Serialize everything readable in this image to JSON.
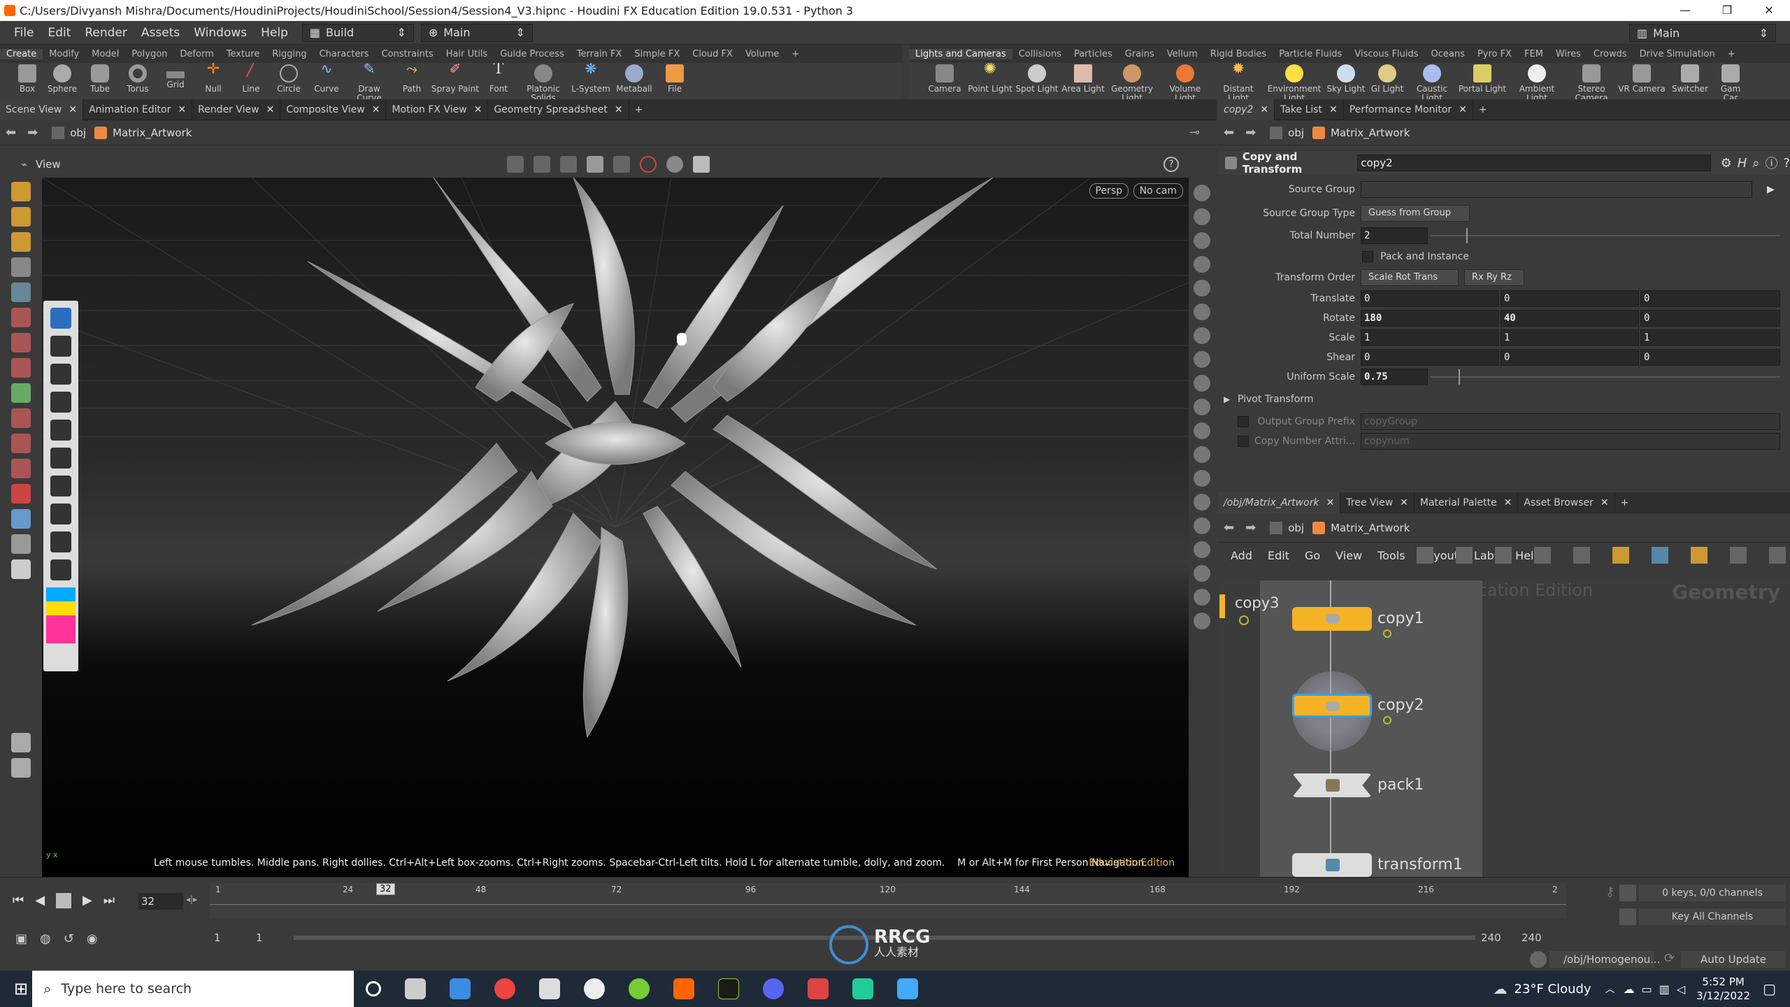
{
  "window": {
    "title": "C:/Users/Divyansh Mishra/Documents/HoudiniProjects/HoudiniSchool/Session4/Session4_V3.hipnc - Houdini FX Education Edition 19.0.531 - Python 3",
    "min": "—",
    "max": "❐",
    "close": "✕"
  },
  "menubar": {
    "items": [
      "File",
      "Edit",
      "Render",
      "Assets",
      "Windows",
      "Help"
    ],
    "desktop": "Build",
    "context": "Main",
    "right_context": "Main"
  },
  "shelf_left": {
    "tabs": [
      "Create",
      "Modify",
      "Model",
      "Polygon",
      "Deform",
      "Texture",
      "Rigging",
      "Characters",
      "Constraints",
      "Hair Utils",
      "Guide Process",
      "Terrain FX",
      "Simple FX",
      "Cloud FX",
      "Volume",
      "+"
    ],
    "tools": [
      "Box",
      "Sphere",
      "Tube",
      "Torus",
      "Grid",
      "Null",
      "Line",
      "Circle",
      "Curve",
      "Draw Curve",
      "Path",
      "Spray Paint",
      "Font",
      "Platonic Solids",
      "L-System",
      "Metaball",
      "File"
    ]
  },
  "shelf_right": {
    "tabs": [
      "Lights and Cameras",
      "Collisions",
      "Particles",
      "Grains",
      "Vellum",
      "Rigid Bodies",
      "Particle Fluids",
      "Viscous Fluids",
      "Oceans",
      "Pyro FX",
      "FEM",
      "Wires",
      "Crowds",
      "Drive Simulation",
      "+"
    ],
    "tools": [
      "Camera",
      "Point Light",
      "Spot Light",
      "Area Light",
      "Geometry Light",
      "Volume Light",
      "Distant Light",
      "Environment Light",
      "Sky Light",
      "GI Light",
      "Caustic Light",
      "Portal Light",
      "Ambient Light",
      "Stereo Camera",
      "VR Camera",
      "Switcher",
      "Gam Car"
    ]
  },
  "left_pane": {
    "tabs": [
      "Scene View",
      "Animation Editor",
      "Render View",
      "Composite View",
      "Motion FX View",
      "Geometry Spreadsheet",
      "+"
    ],
    "path": [
      "obj",
      "Matrix_Artwork"
    ],
    "view_label": "View",
    "persp": "Persp",
    "cam": "No cam",
    "help_text": "Left mouse tumbles. Middle pans. Right dollies. Ctrl+Alt+Left box-zooms. Ctrl+Right zooms. Spacebar-Ctrl-Left tilts. Hold L for alternate tumble, dolly, and zoom.    M or Alt+M for First Person Navigation.",
    "edition": "Education Edition"
  },
  "param_pane": {
    "tabs": [
      "copy2",
      "Take List",
      "Performance Monitor",
      "+"
    ],
    "path": [
      "obj",
      "Matrix_Artwork"
    ],
    "node_type": "Copy and Transform",
    "node_name": "copy2",
    "source_group_label": "Source Group",
    "source_group_value": "",
    "source_group_type_label": "Source Group Type",
    "source_group_type_value": "Guess from Group",
    "total_number_label": "Total Number",
    "total_number_value": "2",
    "pack_label": "Pack and Instance",
    "transform_order_label": "Transform Order",
    "transform_order_value": "Scale Rot Trans",
    "rot_order_value": "Rx Ry Rz",
    "translate_label": "Translate",
    "translate": [
      "0",
      "0",
      "0"
    ],
    "rotate_label": "Rotate",
    "rotate": [
      "180",
      "40",
      "0"
    ],
    "scale_label": "Scale",
    "scale": [
      "1",
      "1",
      "1"
    ],
    "shear_label": "Shear",
    "shear": [
      "0",
      "0",
      "0"
    ],
    "uniform_scale_label": "Uniform Scale",
    "uniform_scale_value": "0.75",
    "pivot_label": "Pivot Transform",
    "output_group_label": "Output Group Prefix",
    "output_group_value": "copyGroup",
    "copy_attr_label": "Copy Number Attri...",
    "copy_attr_value": "copynum"
  },
  "network_pane": {
    "tabs": [
      "/obj/Matrix_Artwork",
      "Tree View",
      "Material Palette",
      "Asset Browser",
      "+"
    ],
    "path": [
      "obj",
      "Matrix_Artwork"
    ],
    "menu": [
      "Add",
      "Edit",
      "Go",
      "View",
      "Tools",
      "Layout",
      "Labs",
      "Help"
    ],
    "watermark_edition": "Education Edition",
    "watermark_context": "Geometry",
    "nodes": [
      "copy3",
      "copy1",
      "copy2",
      "pack1",
      "transform1"
    ]
  },
  "timeline": {
    "current_frame": "32",
    "ticks": [
      "1",
      "24",
      "48",
      "72",
      "96",
      "120",
      "144",
      "168",
      "192",
      "216",
      "2"
    ],
    "range_start": "1",
    "range_start2": "1",
    "range_end": "240",
    "range_end2": "240",
    "keys_text": "0 keys, 0/0 channels",
    "key_all": "Key All Channels"
  },
  "status": {
    "path": "/obj/Homogenou...",
    "update": "Auto Update"
  },
  "watermark": {
    "logo_text": "RRCG",
    "logo_sub": "人人素材"
  },
  "taskbar": {
    "search_placeholder": "Type here to search",
    "weather": "23°F  Cloudy",
    "time": "5:52 PM",
    "date": "3/12/2022"
  },
  "colors": {
    "node_yellow": "#f4b324",
    "node_selected_outline": "#3ca0e8",
    "param_bg": "#3a3a3a",
    "viewport_bg": "#000000"
  }
}
